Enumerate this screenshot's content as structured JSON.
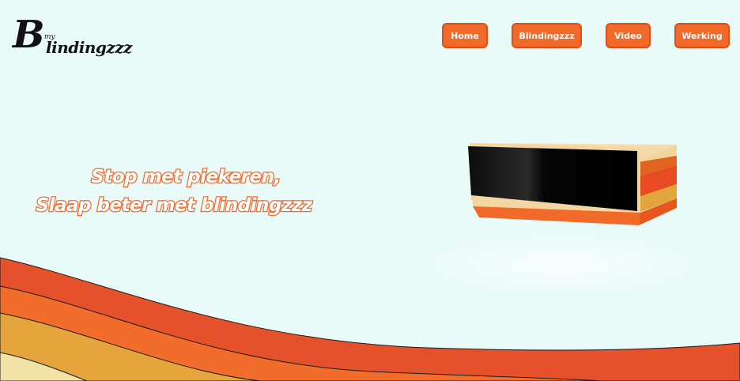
{
  "header": {
    "logo": {
      "letter": "B",
      "small": "my",
      "word": "lindingzzz"
    },
    "nav": [
      {
        "label": "Home"
      },
      {
        "label": "Blindingzzz"
      },
      {
        "label": "Video"
      },
      {
        "label": "Werking"
      }
    ]
  },
  "hero": {
    "line1": "Stop met piekeren,",
    "line2": "Slaap beter met blindingzzz"
  },
  "colors": {
    "background": "#e9fbf8",
    "accent": "#f26a2a",
    "wave_red": "#e4512b",
    "wave_orange": "#f26c2b",
    "wave_yellow": "#e6a53c",
    "wave_cream": "#f3e2a6"
  }
}
